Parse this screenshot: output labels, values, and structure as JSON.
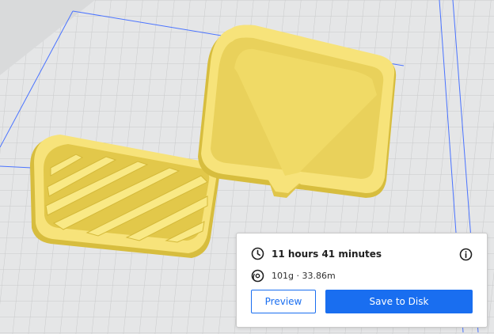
{
  "summary": {
    "print_time": "11 hours 41 minutes",
    "material_usage": "101g · 33.86m",
    "preview_label": "Preview",
    "save_label": "Save to Disk"
  },
  "icons": {
    "time": "clock-icon",
    "material": "spool-icon",
    "info": "info-icon"
  },
  "colors": {
    "build_plate": "#e3e3e3",
    "grid_line": "#c9cacb",
    "build_volume_edge": "#4a73ff",
    "model_yellow": "#f7e37a",
    "model_shadow": "#d7bd3e",
    "accent": "#196ef0"
  }
}
